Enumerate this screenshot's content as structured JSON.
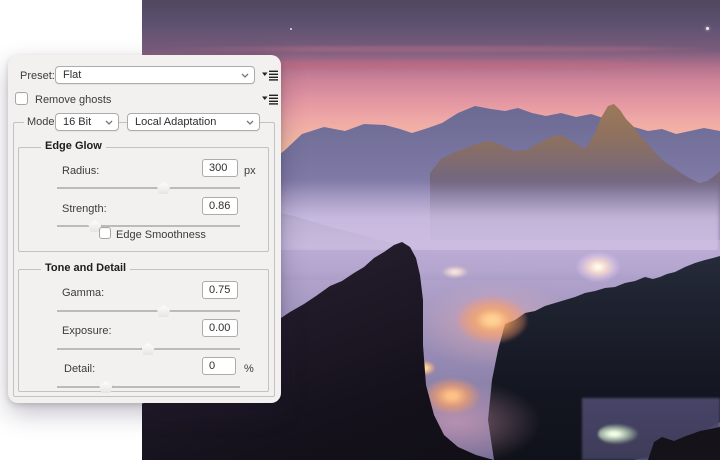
{
  "dialog": {
    "preset": {
      "label": "Preset:",
      "value": "Flat"
    },
    "remove_ghosts": {
      "label": "Remove ghosts",
      "checked": false
    },
    "mode": {
      "label": "Mode:",
      "bit_depth": "16 Bit",
      "method": "Local Adaptation"
    },
    "edge_glow": {
      "title": "Edge Glow",
      "radius": {
        "label": "Radius:",
        "value": "300",
        "unit": "px",
        "slider_pct": 58.5
      },
      "strength": {
        "label": "Strength:",
        "value": "0.86",
        "slider_pct": 21
      },
      "edge_smoothness": {
        "label": "Edge Smoothness",
        "checked": false
      }
    },
    "tone_detail": {
      "title": "Tone and Detail",
      "gamma": {
        "label": "Gamma:",
        "value": "0.75",
        "slider_pct": 58.5
      },
      "exposure": {
        "label": "Exposure:",
        "value": "0.00",
        "slider_pct": 50
      },
      "detail": {
        "label": "Detail:",
        "value": "0",
        "unit": "%",
        "slider_pct": 27
      }
    }
  },
  "photo": {
    "palette": {
      "sky_top": "#51475f",
      "sunset_pink": "#efa8a6",
      "horizon_peach": "#f8c8a2",
      "mountain_haze": "#7d78a4",
      "valley_fog": "#a89dc6",
      "dark_forest": "#14111b",
      "village_light": "#ffc285"
    }
  }
}
